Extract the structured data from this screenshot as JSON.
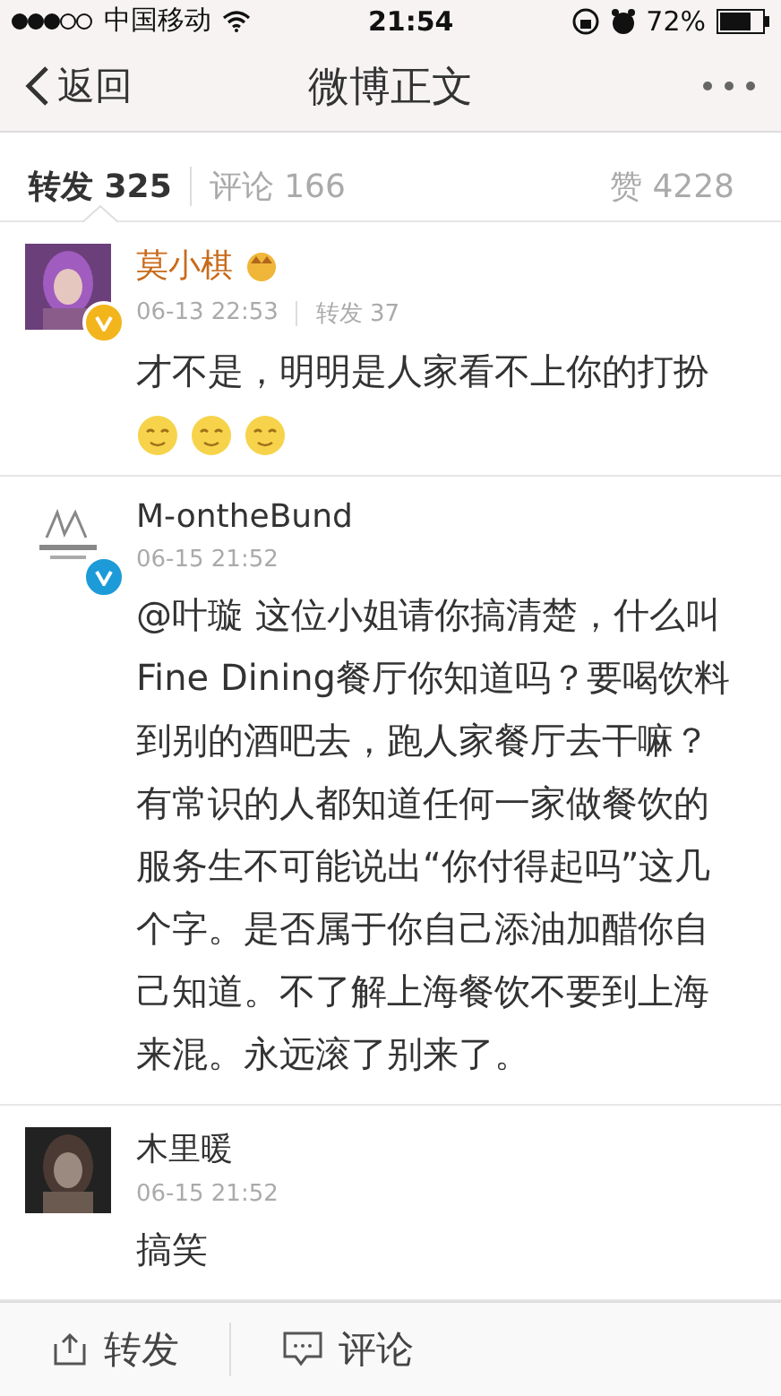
{
  "status_bar": {
    "carrier": "中国移动",
    "time": "21:54",
    "battery": "72%"
  },
  "nav": {
    "back": "返回",
    "title": "微博正文"
  },
  "tabs": [
    {
      "label": "转发 325",
      "selected": true
    },
    {
      "label": "评论 166",
      "selected": false
    },
    {
      "label": "赞 4228",
      "selected": false
    }
  ],
  "comments": [
    {
      "user": "莫小棋",
      "vip": true,
      "badge": {
        "color": "#f2b51b"
      },
      "time": "06-13 22:53",
      "reposts": "转发 37",
      "text": "才不是，明明是人家看不上你的打扮",
      "emojis": [
        {
          "kind": "face"
        },
        {
          "kind": "face"
        },
        {
          "kind": "face"
        }
      ]
    },
    {
      "user": "M-ontheBund",
      "vip": false,
      "badge": {
        "color": "#1d9bd8"
      },
      "time": "06-15 21:52",
      "text": "@叶璇 这位小姐请你搞清楚，什么叫Fine Dining餐厅你知道吗？要喝饮料到别的酒吧去，跑人家餐厅去干嘛？有常识的人都知道任何一家做餐饮的服务生不可能说出“你付得起吗”这几个字。是否属于你自己添油加醋你自己知道。不了解上海餐饮不要到上海来混。永远滚了别来了。",
      "avatar": {
        "kind": "logo"
      }
    },
    {
      "user": "木里暖",
      "vip": false,
      "time": "06-15 21:52",
      "text": "搞笑"
    }
  ],
  "toolbar": [
    {
      "label": "转发",
      "kind": "repost"
    },
    {
      "label": "评论",
      "kind": "comment"
    }
  ]
}
